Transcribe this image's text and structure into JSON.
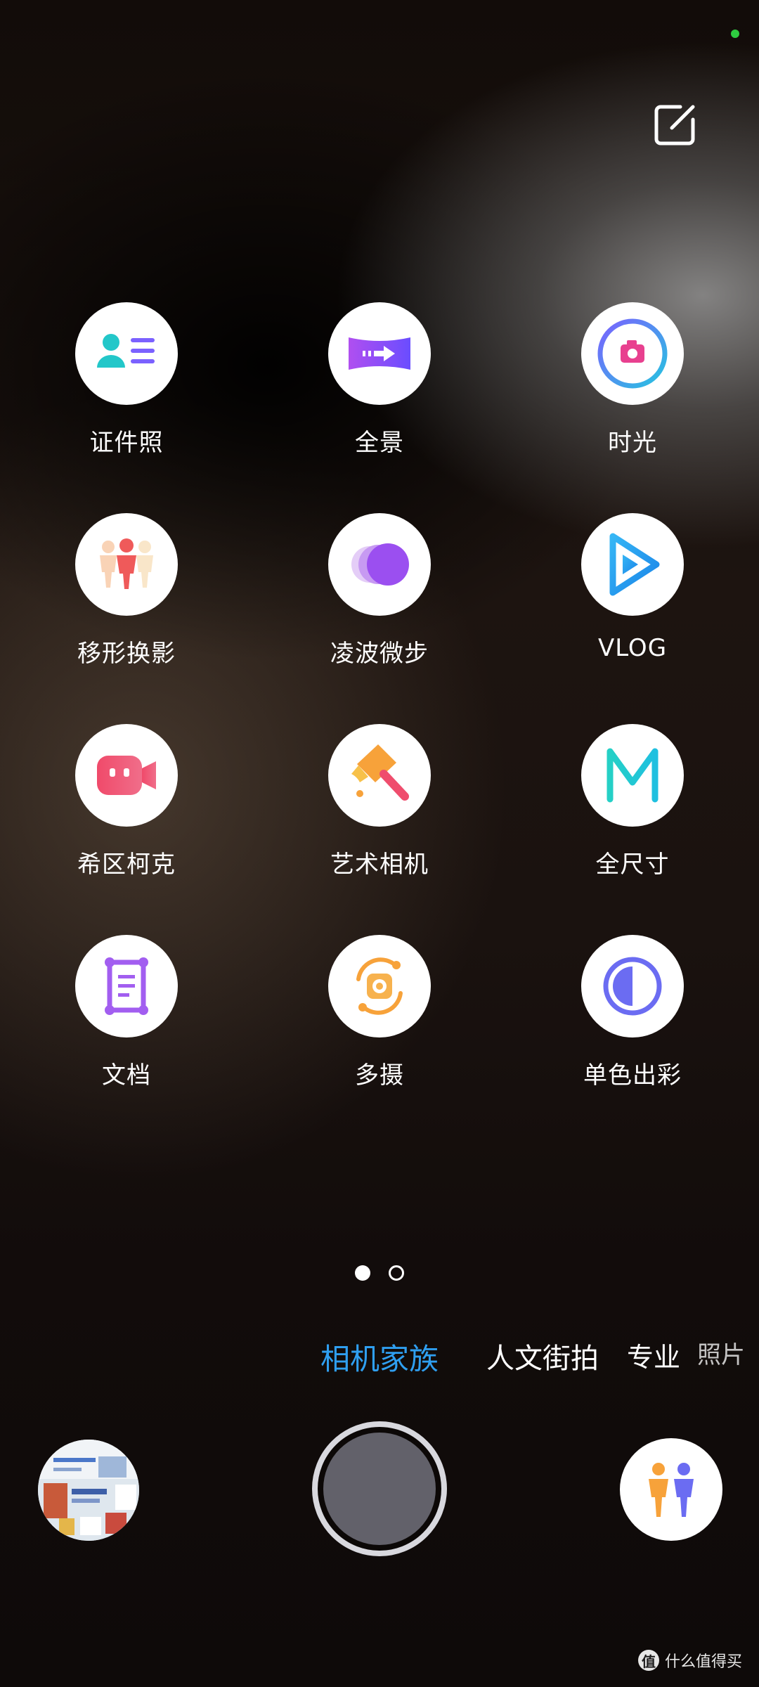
{
  "header": {
    "status_dot_color": "#2ecc40",
    "edit_icon": "edit-icon"
  },
  "modes_grid": [
    {
      "label": "证件照",
      "icon": "id-photo-icon"
    },
    {
      "label": "全景",
      "icon": "panorama-icon"
    },
    {
      "label": "时光",
      "icon": "timelapse-icon"
    },
    {
      "label": "移形换影",
      "icon": "clone-icon"
    },
    {
      "label": "凌波微步",
      "icon": "slow-shutter-icon"
    },
    {
      "label": "VLOG",
      "icon": "vlog-icon"
    },
    {
      "label": "希区柯克",
      "icon": "hitchcock-icon"
    },
    {
      "label": "艺术相机",
      "icon": "art-camera-icon"
    },
    {
      "label": "全尺寸",
      "icon": "full-size-icon"
    },
    {
      "label": "文档",
      "icon": "document-icon"
    },
    {
      "label": "多摄",
      "icon": "multi-camera-icon"
    },
    {
      "label": "单色出彩",
      "icon": "mono-color-icon"
    }
  ],
  "pager": {
    "current_page": 1,
    "total_pages": 2
  },
  "mode_bar": {
    "items": [
      {
        "label": "相机家族",
        "active": true
      },
      {
        "label": "人文街拍",
        "active": false
      },
      {
        "label": "专业",
        "active": false
      },
      {
        "label": "照片",
        "active": false
      }
    ],
    "active_color": "#2f9ff0"
  },
  "bottom": {
    "gallery_icon": "gallery-thumbnail",
    "shutter_icon": "shutter-button",
    "switch_icon": "people-switch-icon"
  },
  "watermark": {
    "logo": "值",
    "text": "什么值得买"
  }
}
